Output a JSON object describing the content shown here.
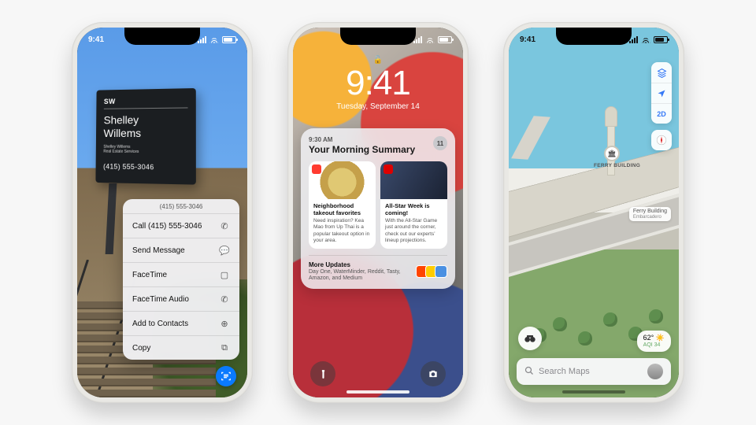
{
  "status": {
    "time": "9:41"
  },
  "phone1": {
    "sign": {
      "monogram": "SW",
      "name": "Shelley\nWillems",
      "sub": "Shelley Willems\nReal Estate Services",
      "phone": "(415) 555-3046"
    },
    "menu": {
      "header": "(415) 555-3046",
      "items": [
        {
          "label": "Call (415) 555-3046",
          "icon": "phone-icon"
        },
        {
          "label": "Send Message",
          "icon": "message-icon"
        },
        {
          "label": "FaceTime",
          "icon": "video-icon"
        },
        {
          "label": "FaceTime Audio",
          "icon": "phone-icon"
        },
        {
          "label": "Add to Contacts",
          "icon": "contact-add-icon"
        },
        {
          "label": "Copy",
          "icon": "copy-icon"
        }
      ]
    },
    "live_text_button": "live-text-icon"
  },
  "phone2": {
    "lock": {
      "time": "9:41",
      "date": "Tuesday, September 14"
    },
    "summary": {
      "time": "9:30 AM",
      "title": "Your Morning Summary",
      "count": "11",
      "cards": [
        {
          "app_icon": "news-app-icon",
          "title": "Neighborhood takeout favorites",
          "desc": "Need inspiration? Kea Mao from Up Thai is a popular takeout option in your area."
        },
        {
          "app_icon": "espn-app-icon",
          "title": "All-Star Week is coming!",
          "desc": "With the All-Star Game just around the corner, check out our experts’ lineup projections."
        }
      ],
      "more": {
        "title": "More Updates",
        "desc": "Day One, WaterMinder, Reddit, Tasty, Amazon, and Medium"
      }
    },
    "buttons": {
      "flashlight": "flashlight-icon",
      "camera": "camera-icon"
    }
  },
  "phone3": {
    "controls": {
      "layers": "map-layers-icon",
      "location": "location-arrow-icon",
      "mode": "2D",
      "compass": "compass-icon"
    },
    "poi": {
      "name": "FERRY BUILDING"
    },
    "labels": [
      {
        "text": "Ferry Building",
        "sub": "Embarcadero"
      }
    ],
    "weather": {
      "temp": "62°",
      "aqi": "AQI 34"
    },
    "binoculars": "binoculars-icon",
    "search": {
      "placeholder": "Search Maps"
    }
  }
}
